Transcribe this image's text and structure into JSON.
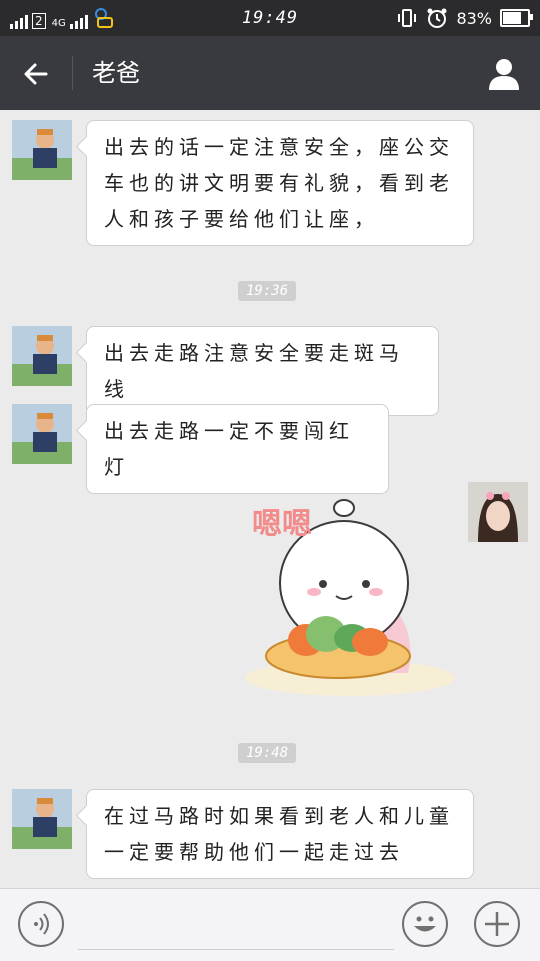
{
  "status_bar": {
    "network_label": "4G",
    "sim_label": "2",
    "time": "19:49",
    "battery": "83%",
    "battery_level": 0.83
  },
  "header": {
    "title": "老爸",
    "back_icon": "arrow-left-icon",
    "profile_icon": "person-icon"
  },
  "messages": [
    {
      "type": "text",
      "sender": "other",
      "lines": [
        "出去的话一定注意安全，座公交",
        "车也的讲文明要有礼貌，看到老",
        "人和孩子要给他们让座，"
      ]
    },
    {
      "type": "timestamp",
      "text": "19:36"
    },
    {
      "type": "text",
      "sender": "other",
      "lines": [
        "出去走路注意安全要走斑马线"
      ]
    },
    {
      "type": "text",
      "sender": "other",
      "lines": [
        "出去走路一定不要闯红灯"
      ]
    },
    {
      "type": "sticker",
      "sender": "me",
      "caption": "嗯嗯"
    },
    {
      "type": "timestamp",
      "text": "19:48"
    },
    {
      "type": "text",
      "sender": "other",
      "lines": [
        "在过马路时如果看到老人和儿童",
        "一定要帮助他们一起走过去"
      ]
    }
  ],
  "input_bar": {
    "voice_icon": "voice-icon",
    "emoji_icon": "emoji-icon",
    "more_icon": "plus-icon",
    "placeholder": ""
  }
}
